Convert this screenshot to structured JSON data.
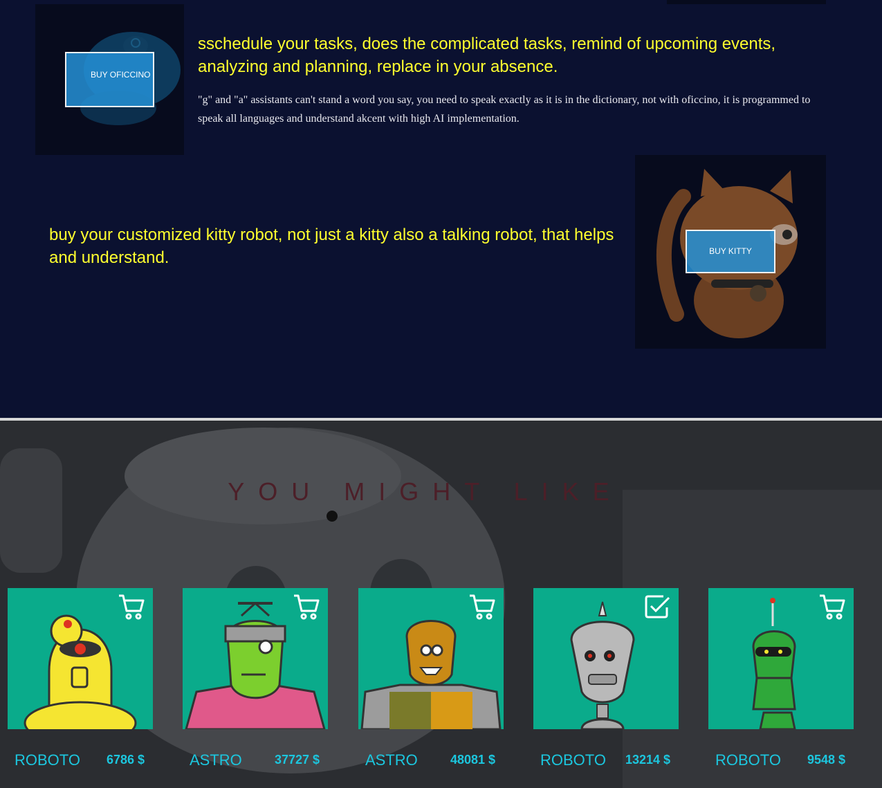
{
  "features": {
    "oficcino": {
      "button_label": "BUY OFICCINO",
      "headline": "sschedule your tasks, does the complicated tasks, remind of upcoming events, analyzing and planning, replace in your absence.",
      "paragraph": "\"g\" and \"a\" assistants can't stand a word you say, you need to speak exactly as it is in the dictionary, not with oficcino, it is programmed to speak all languages and understand akcent with high AI implementation."
    },
    "kitty": {
      "headline": "buy your customized kitty robot, not just a kitty also a talking robot, that helps and understand.",
      "button_label": "BUY KITTY"
    }
  },
  "recommendations": {
    "title": "YOU MIGHT LIKE",
    "products": [
      {
        "name": "ROBOTO",
        "price": "6786 $",
        "cart_icon": "cart-icon",
        "color": "#f5e531"
      },
      {
        "name": "ASTRO",
        "price": "37727 $",
        "cart_icon": "cart-icon",
        "color": "#7ccf2e"
      },
      {
        "name": "ASTRO",
        "price": "48081 $",
        "cart_icon": "cart-icon",
        "color": "#c98a16"
      },
      {
        "name": "ROBOTO",
        "price": "13214 $",
        "cart_icon": "checkbox-checked-icon",
        "color": "#b9b9b9"
      },
      {
        "name": "ROBOTO",
        "price": "9548 $",
        "cart_icon": "cart-icon",
        "color": "#2fa83a"
      }
    ]
  },
  "colors": {
    "page_bg": "#0b1130",
    "headline": "#ffff2e",
    "card_bg": "#0aab8b",
    "accent_text": "#1cc6de",
    "button_bg": "#2490d6"
  }
}
